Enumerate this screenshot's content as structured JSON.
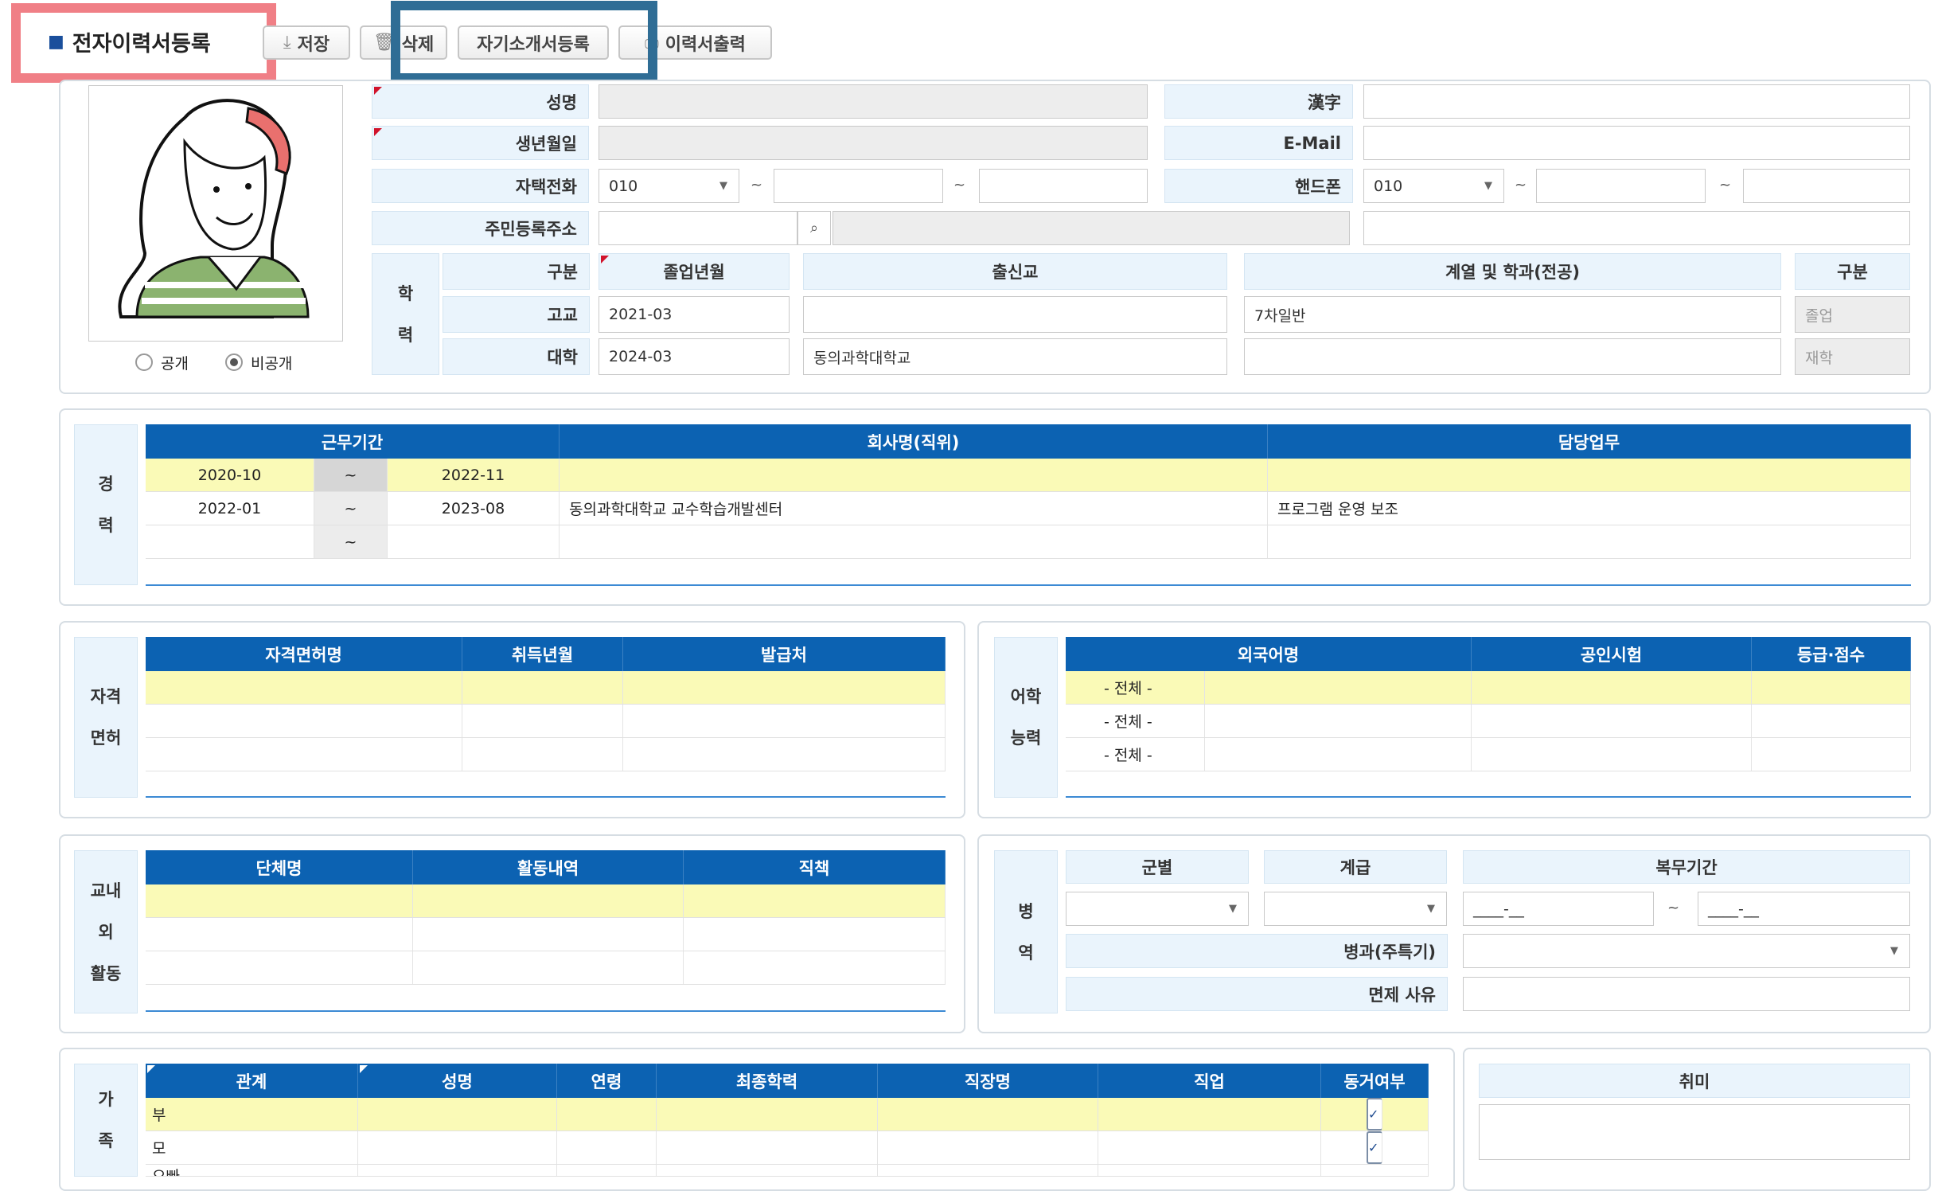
{
  "toolbar": {
    "title": "전자이력서등록",
    "save": "저장",
    "delete": "삭제",
    "intro": "자기소개서등록",
    "print": "이력서출력"
  },
  "photo": {
    "public": "공개",
    "private": "비공개"
  },
  "basic": {
    "name_label": "성명",
    "name_value": "",
    "hanja_label": "漢字",
    "hanja_value": "",
    "birth_label": "생년월일",
    "birth_value": "",
    "email_label": "E-Mail",
    "email_value": "",
    "home_phone_label": "자택전화",
    "home_phone_prefix": "010",
    "home_phone_mid": "",
    "home_phone_last": "",
    "mobile_label": "핸드폰",
    "mobile_prefix": "010",
    "mobile_mid": "",
    "mobile_last": "",
    "address_label": "주민등록주소",
    "zip_value": "",
    "address_value": "",
    "address_detail": "",
    "tilde": "~"
  },
  "education": {
    "side": [
      "학",
      "력"
    ],
    "headers": [
      "구분",
      "졸업년월",
      "출신교",
      "계열 및 학과(전공)",
      "구분"
    ],
    "rows": [
      {
        "type": "고교",
        "grad": "2021-03",
        "school": "",
        "major": "7차일반",
        "status": "졸업"
      },
      {
        "type": "대학",
        "grad": "2024-03",
        "school": "동의과학대학교",
        "major": "",
        "status": "재학"
      }
    ]
  },
  "career": {
    "side": [
      "경",
      "력"
    ],
    "headers": [
      "근무기간",
      "회사명(직위)",
      "담당업무"
    ],
    "rows": [
      {
        "start": "2020-10",
        "sep": "~",
        "end": "2022-11",
        "company": "",
        "duty": ""
      },
      {
        "start": "2022-01",
        "sep": "~",
        "end": "2023-08",
        "company": "동의과학대학교 교수학습개발센터",
        "duty": "프로그램 운영 보조"
      },
      {
        "start": "",
        "sep": "~",
        "end": "",
        "company": "",
        "duty": ""
      }
    ]
  },
  "license": {
    "side": [
      "자격",
      "면허"
    ],
    "headers": [
      "자격면허명",
      "취득년월",
      "발급처"
    ]
  },
  "language": {
    "side": [
      "어학",
      "능력"
    ],
    "headers": [
      "외국어명",
      "공인시험",
      "등급·점수"
    ],
    "rows": [
      "- 전체 -",
      "- 전체 -",
      "- 전체 -"
    ]
  },
  "activity": {
    "side": [
      "교내",
      "외",
      "활동"
    ],
    "headers": [
      "단체명",
      "활동내역",
      "직책"
    ]
  },
  "military": {
    "side": [
      "병",
      "역"
    ],
    "branch_label": "군별",
    "rank_label": "계급",
    "period_label": "복무기간",
    "period_from": "____-__",
    "period_to": "____-__",
    "tilde": "~",
    "specialty_label": "병과(주특기)",
    "exempt_label": "면제 사유"
  },
  "family": {
    "side": [
      "가",
      "족"
    ],
    "headers": [
      "관계",
      "성명",
      "연령",
      "최종학력",
      "직장명",
      "직업",
      "동거여부"
    ],
    "rows": [
      {
        "relation": "부",
        "cohabit": true
      },
      {
        "relation": "모",
        "cohabit": true
      },
      {
        "relation": "오빠",
        "cohabit": false
      }
    ]
  },
  "hobby": {
    "label": "취미",
    "value": ""
  }
}
